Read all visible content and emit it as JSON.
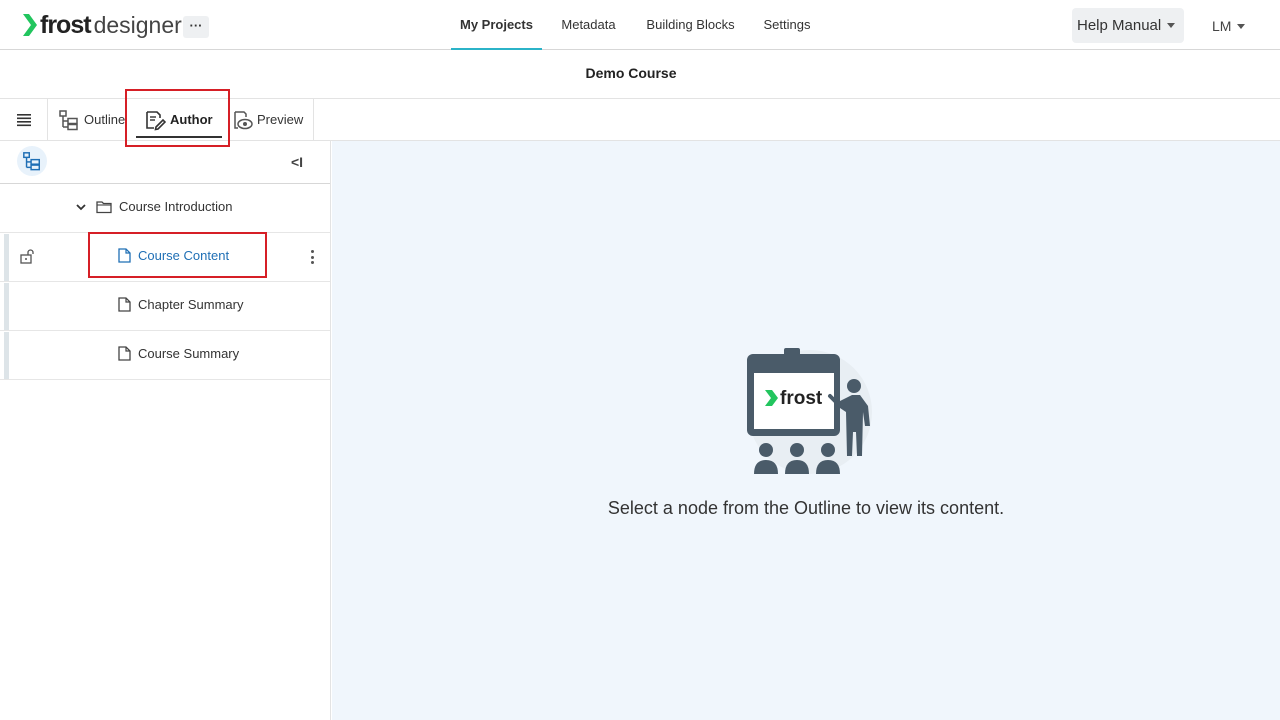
{
  "app": {
    "logo_frost": "frost",
    "logo_designer": "designer",
    "more_label": "···"
  },
  "nav": {
    "tabs": [
      {
        "label": "My Projects",
        "active": true
      },
      {
        "label": "Metadata",
        "active": false
      },
      {
        "label": "Building Blocks",
        "active": false
      },
      {
        "label": "Settings",
        "active": false
      }
    ],
    "help_label": "Help Manual",
    "user_initials": "LM"
  },
  "course": {
    "title": "Demo Course"
  },
  "toolbar": {
    "tabs": [
      {
        "label": "Outline",
        "active": false
      },
      {
        "label": "Author",
        "active": true
      },
      {
        "label": "Preview",
        "active": false
      }
    ]
  },
  "sidebar": {
    "collapse_label": "<I",
    "tree": [
      {
        "label": "Course Introduction",
        "type": "folder",
        "expanded": true
      },
      {
        "label": "Course Content",
        "type": "page",
        "selected": true,
        "unlocked": true
      },
      {
        "label": "Chapter Summary",
        "type": "page",
        "selected": false
      },
      {
        "label": "Course Summary",
        "type": "page",
        "selected": false
      }
    ]
  },
  "main": {
    "illustration_brand": "frost",
    "empty_message": "Select a node from the Outline to view its content."
  },
  "colors": {
    "accent": "#2bb3c8",
    "brand_green": "#22c55e",
    "selected_text": "#1f6fb5",
    "highlight_red": "#d61f26",
    "main_background": "#f0f6fc",
    "illustration": "#4a5b69"
  }
}
